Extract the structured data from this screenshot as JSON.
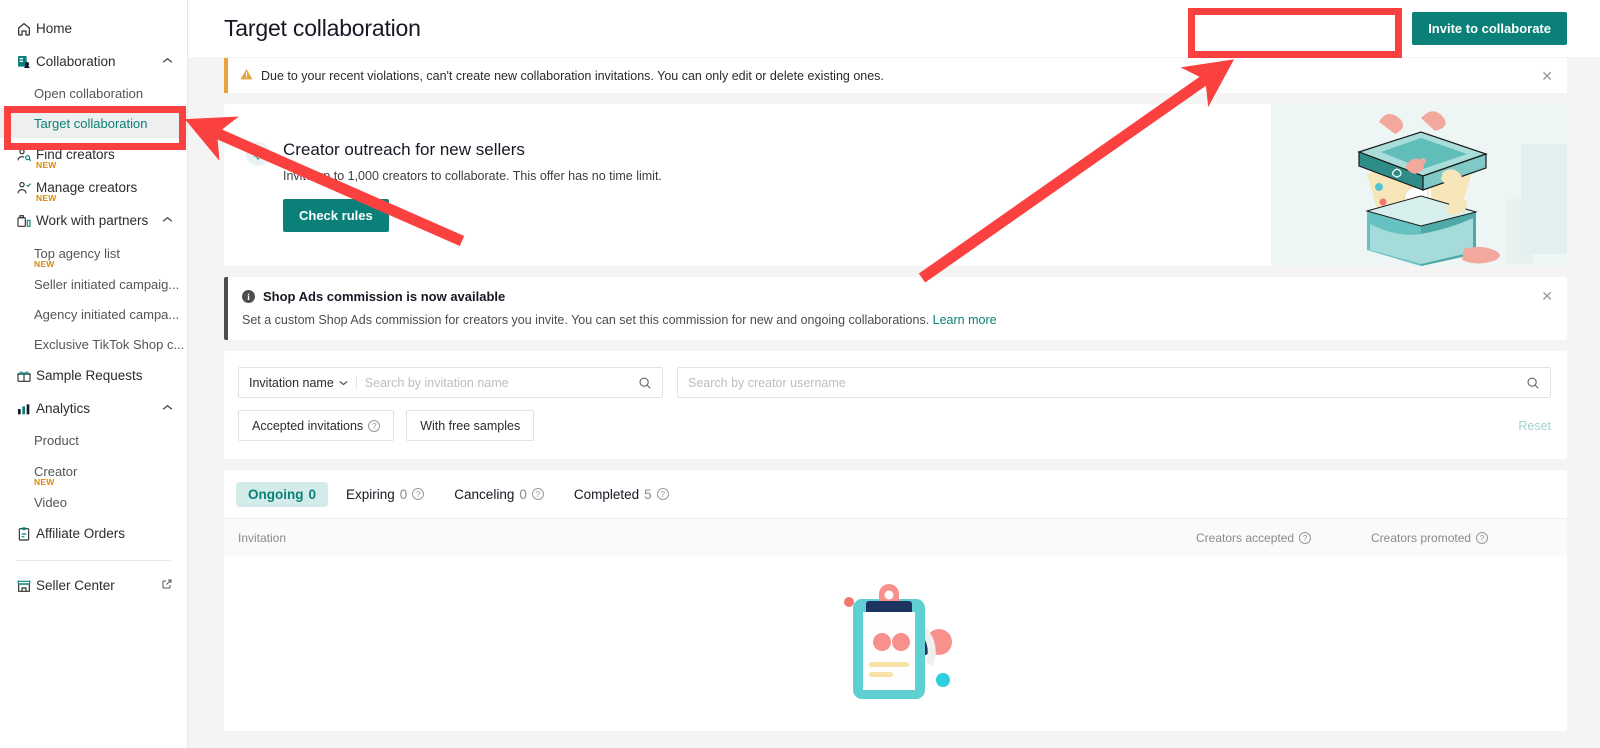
{
  "sidebar": {
    "items": [
      {
        "label": "Home",
        "icon": "home-icon",
        "type": "top"
      },
      {
        "label": "Collaboration",
        "icon": "collaboration-icon",
        "type": "top",
        "chevron": "up"
      },
      {
        "label": "Open collaboration",
        "type": "sub"
      },
      {
        "label": "Target collaboration",
        "type": "sub",
        "selected": true
      },
      {
        "label": "Find creators",
        "icon": "find-creators-icon",
        "type": "top",
        "badge": "NEW"
      },
      {
        "label": "Manage creators",
        "icon": "manage-creators-icon",
        "type": "top",
        "badge": "NEW"
      },
      {
        "label": "Work with partners",
        "icon": "partners-icon",
        "type": "top",
        "chevron": "up"
      },
      {
        "label": "Top agency list",
        "type": "sub",
        "badge": "NEW"
      },
      {
        "label": "Seller initiated campaig...",
        "type": "sub"
      },
      {
        "label": "Agency initiated campa...",
        "type": "sub"
      },
      {
        "label": "Exclusive TikTok Shop c...",
        "type": "sub"
      },
      {
        "label": "Sample Requests",
        "icon": "gift-icon",
        "type": "top"
      },
      {
        "label": "Analytics",
        "icon": "analytics-icon",
        "type": "top",
        "chevron": "up"
      },
      {
        "label": "Product",
        "type": "sub"
      },
      {
        "label": "Creator",
        "type": "sub",
        "badge": "NEW"
      },
      {
        "label": "Video",
        "type": "sub"
      },
      {
        "label": "Affiliate Orders",
        "icon": "clipboard-icon",
        "type": "top"
      }
    ],
    "footer": {
      "label": "Seller Center",
      "icon": "store-icon",
      "external_icon": "external-link-icon"
    }
  },
  "header": {
    "title": "Target collaboration",
    "invite_button": "Invite to collaborate"
  },
  "warning_banner": {
    "icon": "warning-triangle-icon",
    "text": "Due to your recent violations, can't create new collaboration invitations. You can only edit or delete existing ones.",
    "close_icon": "close-icon"
  },
  "promo_card": {
    "icon": "lightbulb-icon",
    "title": "Creator outreach for new sellers",
    "subtitle": "Invite up to 1,000 creators to collaborate. This offer has no time limit.",
    "button": "Check rules",
    "illustration": "gift-box-tiktok-illustration"
  },
  "info_banner": {
    "icon": "info-icon",
    "title": "Shop Ads commission is now available",
    "text": "Set a custom Shop Ads commission for creators you invite. You can set this commission for new and ongoing collaborations.",
    "link": "Learn more",
    "close_icon": "close-icon"
  },
  "filters": {
    "name_select": "Invitation name",
    "chevron_icon": "chevron-down-icon",
    "invitation_placeholder": "Search by invitation name",
    "invitation_value": "",
    "creator_placeholder": "Search by creator username",
    "creator_value": "",
    "search_icon": "search-icon",
    "chips": [
      {
        "label": "Accepted invitations",
        "help": true
      },
      {
        "label": "With free samples",
        "help": false
      }
    ],
    "reset": "Reset"
  },
  "tabs": [
    {
      "label": "Ongoing",
      "count": "0",
      "active": true,
      "help": false
    },
    {
      "label": "Expiring",
      "count": "0",
      "active": false,
      "help": true
    },
    {
      "label": "Canceling",
      "count": "0",
      "active": false,
      "help": true
    },
    {
      "label": "Completed",
      "count": "5",
      "active": false,
      "help": true
    }
  ],
  "table": {
    "columns": [
      {
        "label": "Invitation",
        "help": false
      },
      {
        "label": "Creators accepted",
        "help": true
      },
      {
        "label": "Creators promoted",
        "help": true
      }
    ],
    "rows": [],
    "empty_illustration": "empty-clipboard-illustration"
  },
  "annotations": {
    "color": "#fb4040",
    "highlight_sidebar": "Target collaboration",
    "highlight_button": "Invite to collaborate"
  },
  "colors": {
    "accent": "#0a8079",
    "tab_active_bg": "#d3ecea",
    "warning": "#e8a33d",
    "annotation_red": "#fb4040",
    "badge_new": "#d98908"
  }
}
